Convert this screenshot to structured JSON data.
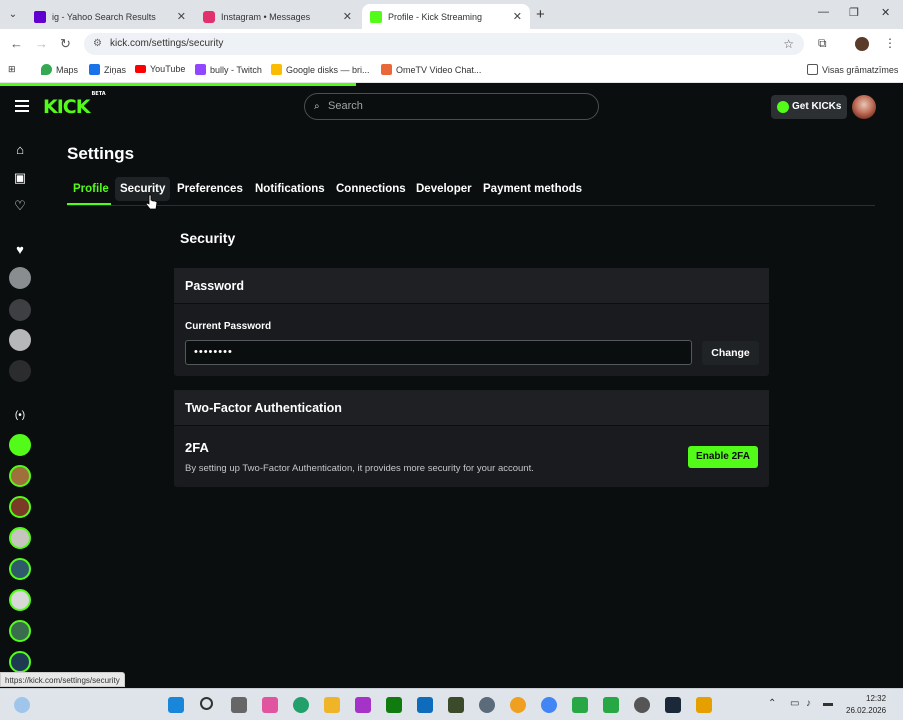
{
  "browser": {
    "tabs": [
      {
        "title": "ig - Yahoo Search Results",
        "favicon_color": "#6001d2"
      },
      {
        "title": "Instagram • Messages",
        "favicon_color": "#e1306c"
      },
      {
        "title": "Profile - Kick Streaming",
        "favicon_color": "#53fc18",
        "active": true
      }
    ],
    "url": "kick.com/settings/security",
    "bookmarks": [
      {
        "label": "Maps",
        "color": "#34a853"
      },
      {
        "label": "Ziņas",
        "color": "#1a73e8"
      },
      {
        "label": "YouTube",
        "color": "#ff0000"
      },
      {
        "label": "bully - Twitch",
        "color": "#9146ff"
      },
      {
        "label": "Google disks — bri...",
        "color": "#fbbc04"
      },
      {
        "label": "OmeTV Video Chat...",
        "color": "#e8683a"
      }
    ],
    "all_bookmarks": "Visas grāmatzīmes",
    "status_url": "https://kick.com/settings/security"
  },
  "kick": {
    "logo": "KICK",
    "logo_badge": "BETA",
    "search_placeholder": "Search",
    "get_kicks": "Get KICKs",
    "accent": "#53fc18"
  },
  "settings": {
    "title": "Settings",
    "tabs": [
      "Profile",
      "Security",
      "Preferences",
      "Notifications",
      "Connections",
      "Developer",
      "Payment methods"
    ],
    "section_title": "Security",
    "password": {
      "header": "Password",
      "label": "Current Password",
      "value": "••••••••",
      "change_label": "Change"
    },
    "twofa": {
      "header": "Two-Factor Authentication",
      "title": "2FA",
      "description": "By setting up Two-Factor Authentication, it provides more security for your account.",
      "button": "Enable 2FA"
    }
  },
  "taskbar": {
    "time": "12:32",
    "date": "26.02.2026"
  }
}
